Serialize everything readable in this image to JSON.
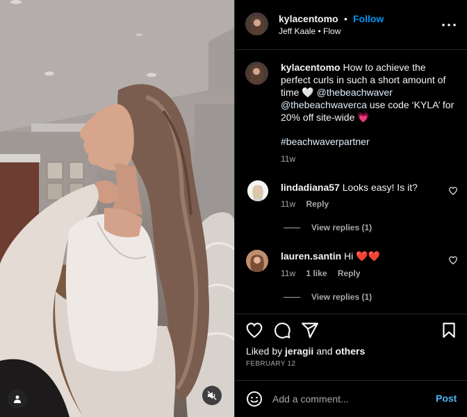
{
  "header": {
    "username": "kylacentomo",
    "separator": "•",
    "follow_label": "Follow",
    "audio": "Jeff Kaale • Flow",
    "avatar_icon": "profile-avatar",
    "more_icon": "more-options-icon"
  },
  "caption": {
    "username": "kylacentomo",
    "text_1": "How to achieve the perfect curls in such a short amount of time",
    "emoji_1": "🤍",
    "mention_1": "@thebeachwaver",
    "mention_2": "@thebeachwaverca",
    "text_2": "use code ‘KYLA’ for 20% off site-wide",
    "emoji_2": "💗",
    "hashtag": "#beachwaverpartner",
    "time": "11w"
  },
  "comments": [
    {
      "username": "lindadiana57",
      "text": "Looks easy! Is it?",
      "time": "11w",
      "likes": "",
      "reply_label": "Reply",
      "view_replies": "View replies (1)"
    },
    {
      "username": "lauren.santin",
      "text": "Hi ❤️❤️",
      "time": "11w",
      "likes": "1 like",
      "reply_label": "Reply",
      "view_replies": "View replies (1)"
    }
  ],
  "actions": {
    "liked_by_prefix": "Liked by",
    "liked_by_user": "jeragii",
    "liked_by_and": "and",
    "liked_by_others": "others",
    "date": "FEBRUARY 12"
  },
  "composer": {
    "placeholder": "Add a comment...",
    "post_label": "Post"
  },
  "colors": {
    "accent": "#0095f6",
    "post": "#4cb5f9",
    "secondary_text": "#a8a8a8",
    "background": "#000000"
  }
}
